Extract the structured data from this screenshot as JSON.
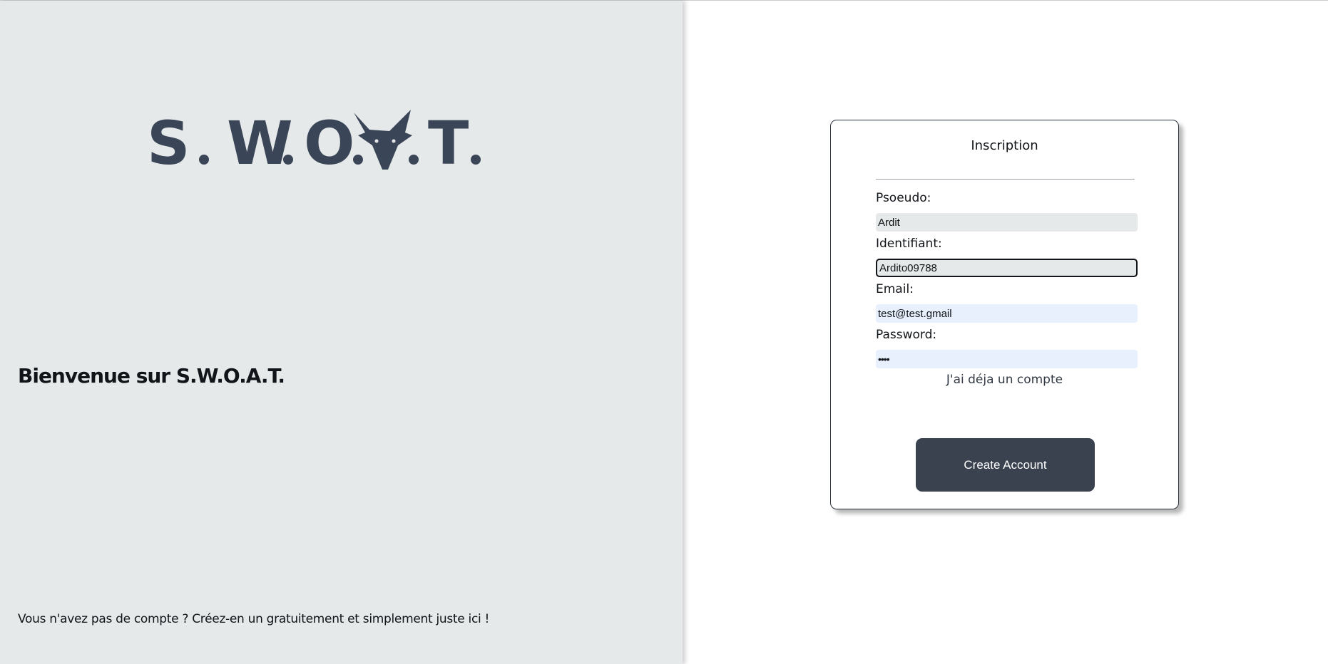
{
  "left_panel": {
    "logo_text": "S.W.O.A.T.",
    "welcome_title": "Bienvenue sur S.W.O.A.T.",
    "welcome_subtitle": "Vous n'avez pas de compte ? Créez-en un gratuitement et simplement juste ici !",
    "background_color": "#e6e9ea",
    "logo_color": "#3a4657"
  },
  "form": {
    "title": "Inscription",
    "fields": {
      "pseudo": {
        "label": "Psoeudo:",
        "value": "Ardit"
      },
      "identifiant": {
        "label": "Identifiant:",
        "value": "Ardito09788"
      },
      "email": {
        "label": "Email:",
        "value": "test@test.gmail"
      },
      "password": {
        "label": "Password:",
        "value": "••••"
      }
    },
    "login_link": "J'ai déja un compte",
    "submit_label": "Create Account",
    "button_color": "#3a4250"
  }
}
